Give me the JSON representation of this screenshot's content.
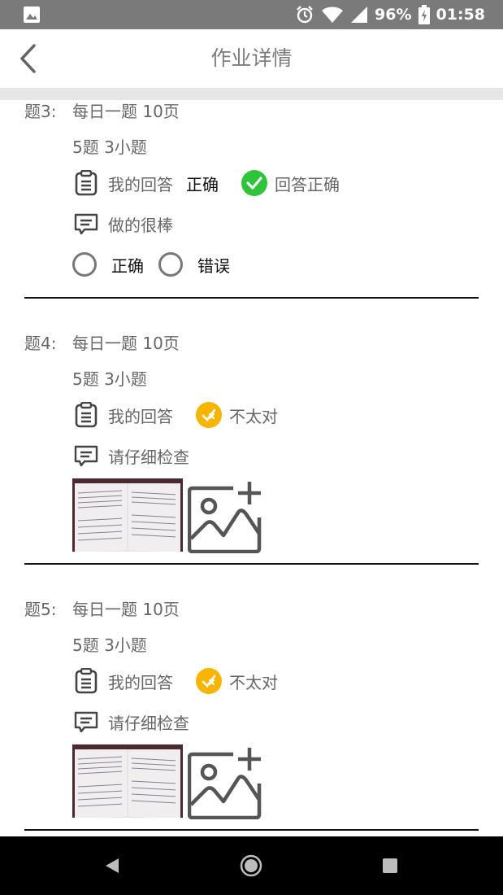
{
  "status_bar": {
    "battery": "96%",
    "time": "01:58",
    "icons": [
      "image-icon",
      "alarm-icon",
      "wifi-icon",
      "signal-icon",
      "battery-icon"
    ]
  },
  "app_bar": {
    "title": "作业详情",
    "back_icon": "chevron-left-icon"
  },
  "questions": [
    {
      "number": "题3:",
      "title": "每日一题 10页",
      "subtitle": "5题 3小题",
      "answer_label": "我的回答",
      "answer_value": "正确",
      "result": "回答正确",
      "result_status": "correct",
      "comment": "做的很棒",
      "options": [
        "正确",
        "错误"
      ]
    },
    {
      "number": "题4:",
      "title": "每日一题 10页",
      "subtitle": "5题 3小题",
      "answer_label": "我的回答",
      "result": "不太对",
      "result_status": "incorrect",
      "comment": "请仔细检查"
    },
    {
      "number": "题5:",
      "title": "每日一题 10页",
      "subtitle": "5题 3小题",
      "answer_label": "我的回答",
      "result": "不太对",
      "result_status": "incorrect",
      "comment": "请仔细检查"
    }
  ],
  "colors": {
    "correct": "#2ec53a",
    "incorrect": "#f7b500",
    "status_bar": "#7a7a7a",
    "divider": "#e6e6e6"
  },
  "nav_bar": {
    "icons": [
      "back-triangle-icon",
      "home-circle-icon",
      "recents-square-icon"
    ]
  }
}
